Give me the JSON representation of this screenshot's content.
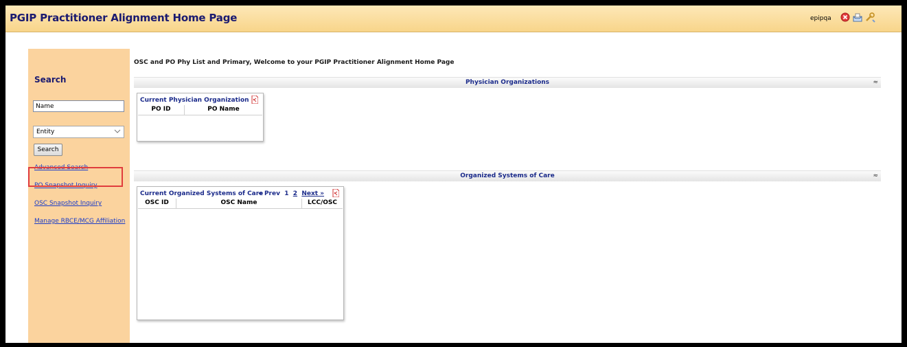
{
  "header": {
    "title": "PGIP Practitioner Alignment Home Page",
    "user": "epipqa",
    "icons": [
      "close-icon",
      "inbox-icon",
      "tools-icon"
    ]
  },
  "sidebar": {
    "heading": "Search",
    "name_value": "Name",
    "entity_selected": "Entity",
    "search_button": "Search",
    "links": {
      "advanced": "Advanced Search",
      "po_snapshot": "PO Snapshot Inquiry",
      "osc_snapshot": "OSC Snapshot Inquiry",
      "manage": "Manage RBCE/MCG Affiliation"
    }
  },
  "main": {
    "welcome": "OSC and PO Phy List and Primary, Welcome to your PGIP Practitioner Alignment Home Page",
    "po_section": {
      "title": "Physician Organizations",
      "panel_title": "Current Physician Organization",
      "columns": [
        "PO ID",
        "PO Name"
      ]
    },
    "osc_section": {
      "title": "Organized Systems of Care",
      "panel_title": "Current Organized Systems of Care",
      "pager": {
        "prev": "« Prev",
        "page1": "1",
        "page2": "2",
        "next": "Next »"
      },
      "columns": [
        "OSC ID",
        "OSC Name",
        "LCC/OSC"
      ]
    },
    "collapse_glyph": "≈"
  },
  "colors": {
    "header_bg": "#f8d58a",
    "sidebar_bg": "#fbd39e",
    "title_text": "#1a1a70",
    "link": "#1a3cc8",
    "highlight": "#e03c3c"
  }
}
